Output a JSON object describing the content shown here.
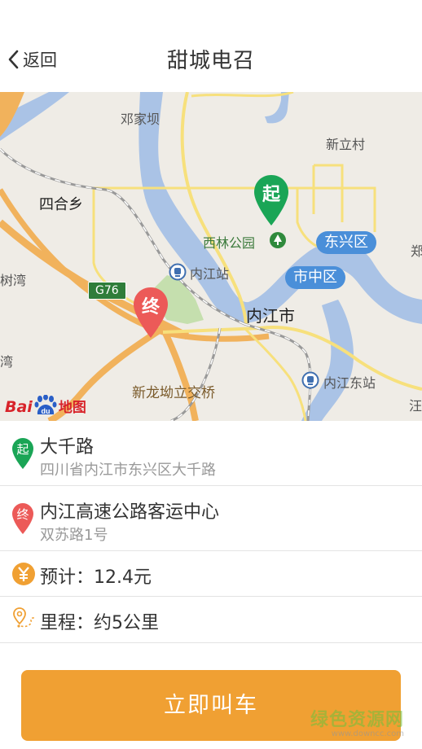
{
  "header": {
    "back_label": "返回",
    "title": "甜城电召"
  },
  "map": {
    "labels": {
      "dengjiaba": "邓家坝",
      "xinlicun": "新立村",
      "sihexiang": "四合乡",
      "xilin_park": "西林公园",
      "dongxing": "东兴区",
      "shuwan": "树湾",
      "neijiang_station": "内江站",
      "shizhong": "市中区",
      "g76": "G76",
      "neijiang_city": "内江市",
      "wan": "湾",
      "neijiang_east": "内江东站",
      "xinlongao": "新龙坳立交桥",
      "edge_right_1": "郑",
      "edge_right_2": "汪"
    },
    "start_pin": "起",
    "end_pin": "终",
    "brand_text": "Bai",
    "brand_du": "du",
    "brand_map": "地图",
    "colors": {
      "water": "#aac3e6",
      "highway": "#f1b25c",
      "road_yellow": "#f7e07c",
      "start_green": "#1aa556",
      "end_red": "#ec5a58",
      "park": "#c5dfae"
    }
  },
  "route": {
    "start": {
      "icon": "起",
      "name": "大千路",
      "address": "四川省内江市东兴区大千路"
    },
    "end": {
      "icon": "终",
      "name": "内江高速公路客运中心",
      "address": "双苏路1号"
    },
    "estimate": {
      "label": "预计：",
      "value": "12.4元"
    },
    "distance": {
      "label": "里程：",
      "value": "约5公里"
    }
  },
  "action": {
    "call_label": "立即叫车"
  },
  "watermark": {
    "cn": "绿色资源网",
    "url": "www.downcc.com"
  }
}
